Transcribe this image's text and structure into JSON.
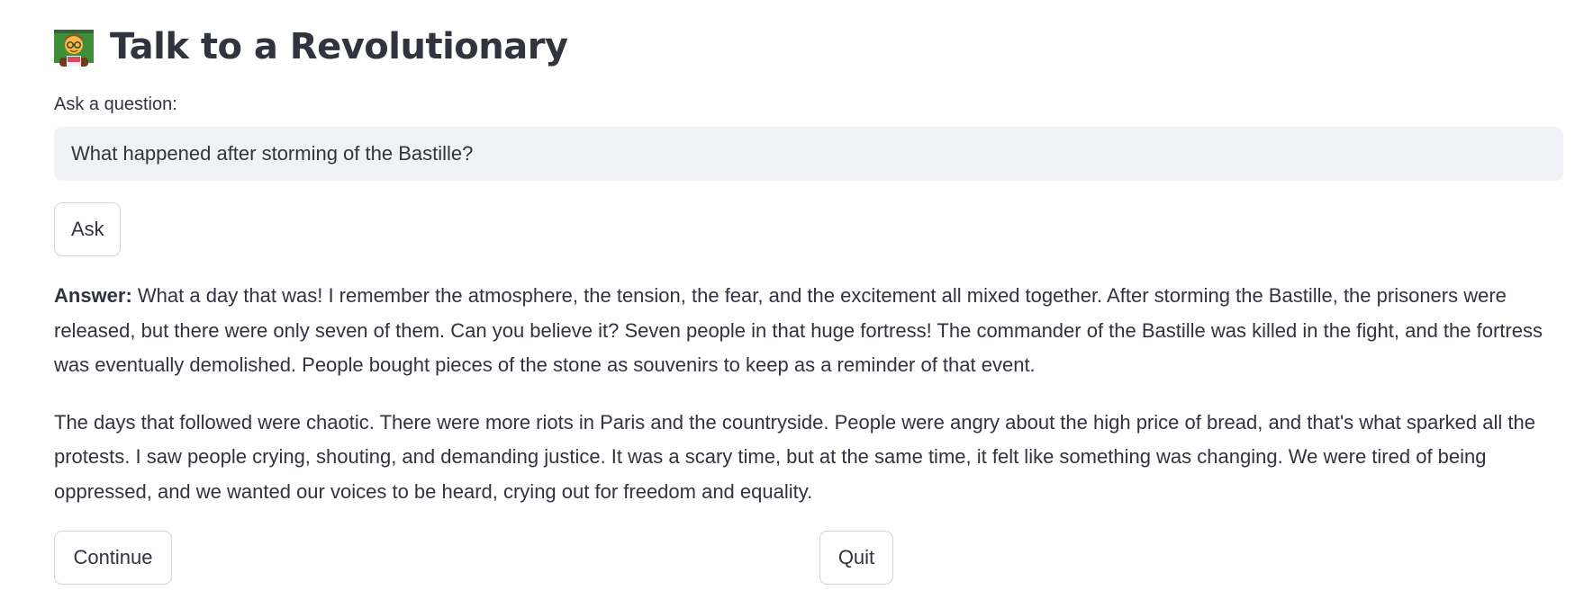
{
  "header": {
    "icon": "teacher-emoji-icon",
    "title": "Talk to a Revolutionary"
  },
  "question": {
    "label": "Ask a question:",
    "value": "What happened after storming of the Bastille?"
  },
  "buttons": {
    "ask": "Ask",
    "continue": "Continue",
    "quit": "Quit"
  },
  "answer": {
    "prefix": "Answer:",
    "paragraph1": " What a day that was! I remember the atmosphere, the tension, the fear, and the excitement all mixed together. After storming the Bastille, the prisoners were released, but there were only seven of them. Can you believe it? Seven people in that huge fortress! The commander of the Bastille was killed in the fight, and the fortress was eventually demolished. People bought pieces of the stone as souvenirs to keep as a reminder of that event.",
    "paragraph2": "The days that followed were chaotic. There were more riots in Paris and the countryside. People were angry about the high price of bread, and that's what sparked all the protests. I saw people crying, shouting, and demanding justice. It was a scary time, but at the same time, it felt like something was changing. We were tired of being oppressed, and we wanted our voices to be heard, crying out for freedom and equality."
  },
  "colors": {
    "text": "#31333f",
    "input_background": "#f0f2f6",
    "button_border": "#d3d4d9",
    "background": "#ffffff"
  }
}
